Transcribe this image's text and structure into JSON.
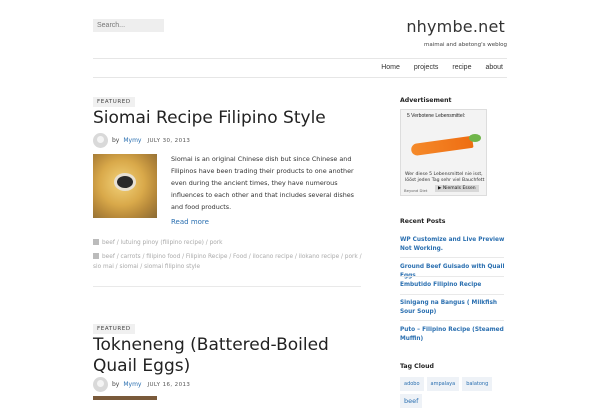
{
  "header": {
    "search_placeholder": "Search...",
    "site_title": "nhymbe.net",
    "tagline": "maimai and abetong's weblog"
  },
  "nav": {
    "items": [
      "Home",
      "projects",
      "recipe",
      "about"
    ]
  },
  "posts": [
    {
      "badge": "FEATURED",
      "title": "Siomai Recipe Filipino Style",
      "by": "by",
      "author": "Mymy",
      "date": "JULY 30, 2013",
      "excerpt": "Siomai is an original Chinese dish but since Chinese and Filipinos have been trading their products to one another even during the ancient times, they have numerous influences to each other and that includes several dishes and food products.",
      "read_more": "Read more",
      "categories": "beef / lutuing pinoy (filipino recipe) / pork",
      "tags": "beef / carrots / filipino food / Filipino Recipe / Food / ilocano recipe / ilokano recipe / pork / sio mai / siomai / siomai filipino style"
    },
    {
      "badge": "FEATURED",
      "title": "Tokneneng (Battered-Boiled Quail Eggs)",
      "by": "by",
      "author": "Mymy",
      "date": "JULY 16, 2013"
    }
  ],
  "sidebar": {
    "ad_title": "Advertisement",
    "ad": {
      "headline": "5 Verbotene Lebensmittel:",
      "body": "Wer diese 5 Lebensmittel nie isst, lööst jeden Tag sehr viel Bauchfett",
      "cta": "▶ Niemals Essen",
      "brand": "Beyond Diet"
    },
    "recent_title": "Recent Posts",
    "recent_posts": [
      "WP Customize and Live Preview Not Working.",
      "Ground Beef Guisado with Quail Eggs",
      "Embutido Filipino Recipe",
      "Sinigang na Bangus ( Milkfish Sour Soup)",
      "Puto – Filipino Recipe (Steamed Muffin)"
    ],
    "tag_cloud_title": "Tag Cloud",
    "tag_cloud": [
      "adobo",
      "ampalaya",
      "balatong",
      "beef"
    ]
  },
  "colors": {
    "link": "#2a6fb0",
    "text": "#333333",
    "badge_bg": "#f0f0f0"
  }
}
